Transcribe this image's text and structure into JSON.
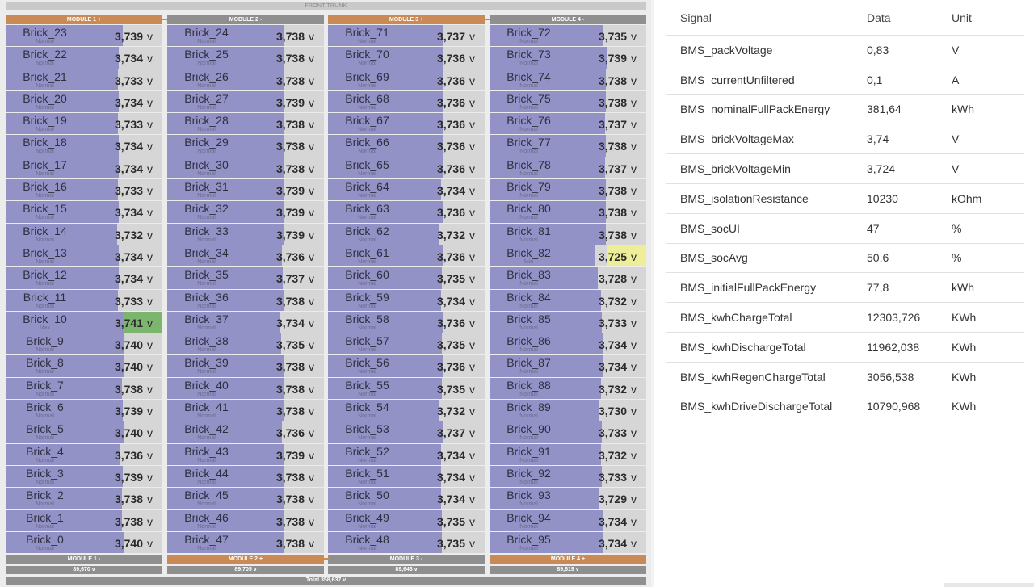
{
  "front_trunk": "FRONT TRUNK",
  "colors": {
    "positive": "#c98a55",
    "negative": "#8f8f8f",
    "bar": "#9392c6",
    "track": "#d6d6d6",
    "max_highlight": "#7cb56e",
    "min_highlight": "#eeee99"
  },
  "fill_scale": {
    "min_voltage": 3.7,
    "max_voltage": 3.745
  },
  "modules": [
    {
      "header": "MODULE 1 +",
      "header_kind": "positive",
      "footer": "MODULE 1 -",
      "footer_kind": "negative",
      "total": "89,670 v",
      "bricks": [
        {
          "name": "Brick_23",
          "status": "Normal",
          "voltage": "3,739"
        },
        {
          "name": "Brick_22",
          "status": "Normal",
          "voltage": "3,734"
        },
        {
          "name": "Brick_21",
          "status": "Normal",
          "voltage": "3,733"
        },
        {
          "name": "Brick_20",
          "status": "Normal",
          "voltage": "3,734"
        },
        {
          "name": "Brick_19",
          "status": "Normal",
          "voltage": "3,733"
        },
        {
          "name": "Brick_18",
          "status": "Normal",
          "voltage": "3,734"
        },
        {
          "name": "Brick_17",
          "status": "Normal",
          "voltage": "3,734"
        },
        {
          "name": "Brick_16",
          "status": "Normal",
          "voltage": "3,733"
        },
        {
          "name": "Brick_15",
          "status": "Normal",
          "voltage": "3,734"
        },
        {
          "name": "Brick_14",
          "status": "Normal",
          "voltage": "3,732"
        },
        {
          "name": "Brick_13",
          "status": "Normal",
          "voltage": "3,734"
        },
        {
          "name": "Brick_12",
          "status": "Normal",
          "voltage": "3,734"
        },
        {
          "name": "Brick_11",
          "status": "Normal",
          "voltage": "3,733"
        },
        {
          "name": "Brick_10",
          "status": "Max",
          "voltage": "3,741"
        },
        {
          "name": "Brick_9",
          "status": "Normal",
          "voltage": "3,740"
        },
        {
          "name": "Brick_8",
          "status": "Normal",
          "voltage": "3,740"
        },
        {
          "name": "Brick_7",
          "status": "Normal",
          "voltage": "3,738"
        },
        {
          "name": "Brick_6",
          "status": "Normal",
          "voltage": "3,739"
        },
        {
          "name": "Brick_5",
          "status": "Normal",
          "voltage": "3,740"
        },
        {
          "name": "Brick_4",
          "status": "Normal",
          "voltage": "3,736"
        },
        {
          "name": "Brick_3",
          "status": "Normal",
          "voltage": "3,739"
        },
        {
          "name": "Brick_2",
          "status": "Normal",
          "voltage": "3,738"
        },
        {
          "name": "Brick_1",
          "status": "Normal",
          "voltage": "3,738"
        },
        {
          "name": "Brick_0",
          "status": "Normal",
          "voltage": "3,740"
        }
      ]
    },
    {
      "header": "MODULE 2 -",
      "header_kind": "negative",
      "footer": "MODULE 2 +",
      "footer_kind": "positive",
      "total": "89,705 v",
      "bricks": [
        {
          "name": "Brick_24",
          "status": "Normal",
          "voltage": "3,738"
        },
        {
          "name": "Brick_25",
          "status": "Normal",
          "voltage": "3,738"
        },
        {
          "name": "Brick_26",
          "status": "Normal",
          "voltage": "3,738"
        },
        {
          "name": "Brick_27",
          "status": "Normal",
          "voltage": "3,739"
        },
        {
          "name": "Brick_28",
          "status": "Normal",
          "voltage": "3,738"
        },
        {
          "name": "Brick_29",
          "status": "Normal",
          "voltage": "3,738"
        },
        {
          "name": "Brick_30",
          "status": "Normal",
          "voltage": "3,738"
        },
        {
          "name": "Brick_31",
          "status": "Normal",
          "voltage": "3,739"
        },
        {
          "name": "Brick_32",
          "status": "Normal",
          "voltage": "3,739"
        },
        {
          "name": "Brick_33",
          "status": "Normal",
          "voltage": "3,739"
        },
        {
          "name": "Brick_34",
          "status": "Normal",
          "voltage": "3,736"
        },
        {
          "name": "Brick_35",
          "status": "Normal",
          "voltage": "3,737"
        },
        {
          "name": "Brick_36",
          "status": "Normal",
          "voltage": "3,738"
        },
        {
          "name": "Brick_37",
          "status": "Normal",
          "voltage": "3,734"
        },
        {
          "name": "Brick_38",
          "status": "Normal",
          "voltage": "3,735"
        },
        {
          "name": "Brick_39",
          "status": "Normal",
          "voltage": "3,738"
        },
        {
          "name": "Brick_40",
          "status": "Normal",
          "voltage": "3,738"
        },
        {
          "name": "Brick_41",
          "status": "Normal",
          "voltage": "3,738"
        },
        {
          "name": "Brick_42",
          "status": "Normal",
          "voltage": "3,736"
        },
        {
          "name": "Brick_43",
          "status": "Normal",
          "voltage": "3,739"
        },
        {
          "name": "Brick_44",
          "status": "Normal",
          "voltage": "3,738"
        },
        {
          "name": "Brick_45",
          "status": "Normal",
          "voltage": "3,738"
        },
        {
          "name": "Brick_46",
          "status": "Normal",
          "voltage": "3,738"
        },
        {
          "name": "Brick_47",
          "status": "Normal",
          "voltage": "3,738"
        }
      ]
    },
    {
      "header": "MODULE 3 +",
      "header_kind": "positive",
      "footer": "MODULE 3 -",
      "footer_kind": "negative",
      "total": "89,643 v",
      "bricks": [
        {
          "name": "Brick_71",
          "status": "Normal",
          "voltage": "3,737"
        },
        {
          "name": "Brick_70",
          "status": "Normal",
          "voltage": "3,736"
        },
        {
          "name": "Brick_69",
          "status": "Normal",
          "voltage": "3,736"
        },
        {
          "name": "Brick_68",
          "status": "Normal",
          "voltage": "3,736"
        },
        {
          "name": "Brick_67",
          "status": "Normal",
          "voltage": "3,736"
        },
        {
          "name": "Brick_66",
          "status": "Normal",
          "voltage": "3,736"
        },
        {
          "name": "Brick_65",
          "status": "Normal",
          "voltage": "3,736"
        },
        {
          "name": "Brick_64",
          "status": "Normal",
          "voltage": "3,734"
        },
        {
          "name": "Brick_63",
          "status": "Normal",
          "voltage": "3,736"
        },
        {
          "name": "Brick_62",
          "status": "Normal",
          "voltage": "3,732"
        },
        {
          "name": "Brick_61",
          "status": "Normal",
          "voltage": "3,736"
        },
        {
          "name": "Brick_60",
          "status": "Normal",
          "voltage": "3,735"
        },
        {
          "name": "Brick_59",
          "status": "Normal",
          "voltage": "3,734"
        },
        {
          "name": "Brick_58",
          "status": "Normal",
          "voltage": "3,736"
        },
        {
          "name": "Brick_57",
          "status": "Normal",
          "voltage": "3,735"
        },
        {
          "name": "Brick_56",
          "status": "Normal",
          "voltage": "3,736"
        },
        {
          "name": "Brick_55",
          "status": "Normal",
          "voltage": "3,735"
        },
        {
          "name": "Brick_54",
          "status": "Normal",
          "voltage": "3,732"
        },
        {
          "name": "Brick_53",
          "status": "Normal",
          "voltage": "3,737"
        },
        {
          "name": "Brick_52",
          "status": "Normal",
          "voltage": "3,734"
        },
        {
          "name": "Brick_51",
          "status": "Normal",
          "voltage": "3,734"
        },
        {
          "name": "Brick_50",
          "status": "Normal",
          "voltage": "3,734"
        },
        {
          "name": "Brick_49",
          "status": "Normal",
          "voltage": "3,735"
        },
        {
          "name": "Brick_48",
          "status": "Normal",
          "voltage": "3,735"
        }
      ]
    },
    {
      "header": "MODULE 4 -",
      "header_kind": "negative",
      "footer": "MODULE 4 +",
      "footer_kind": "positive",
      "total": "89,619 v",
      "bricks": [
        {
          "name": "Brick_72",
          "status": "Normal",
          "voltage": "3,735"
        },
        {
          "name": "Brick_73",
          "status": "Normal",
          "voltage": "3,739"
        },
        {
          "name": "Brick_74",
          "status": "Normal",
          "voltage": "3,738"
        },
        {
          "name": "Brick_75",
          "status": "Normal",
          "voltage": "3,738"
        },
        {
          "name": "Brick_76",
          "status": "Normal",
          "voltage": "3,737"
        },
        {
          "name": "Brick_77",
          "status": "Normal",
          "voltage": "3,738"
        },
        {
          "name": "Brick_78",
          "status": "Normal",
          "voltage": "3,737"
        },
        {
          "name": "Brick_79",
          "status": "Normal",
          "voltage": "3,738"
        },
        {
          "name": "Brick_80",
          "status": "Normal",
          "voltage": "3,738"
        },
        {
          "name": "Brick_81",
          "status": "Normal",
          "voltage": "3,738"
        },
        {
          "name": "Brick_82",
          "status": "Min",
          "voltage": "3,725"
        },
        {
          "name": "Brick_83",
          "status": "Normal",
          "voltage": "3,728"
        },
        {
          "name": "Brick_84",
          "status": "Normal",
          "voltage": "3,732"
        },
        {
          "name": "Brick_85",
          "status": "Normal",
          "voltage": "3,733"
        },
        {
          "name": "Brick_86",
          "status": "Normal",
          "voltage": "3,734"
        },
        {
          "name": "Brick_87",
          "status": "Normal",
          "voltage": "3,734"
        },
        {
          "name": "Brick_88",
          "status": "Normal",
          "voltage": "3,732"
        },
        {
          "name": "Brick_89",
          "status": "Normal",
          "voltage": "3,730"
        },
        {
          "name": "Brick_90",
          "status": "Normal",
          "voltage": "3,733"
        },
        {
          "name": "Brick_91",
          "status": "Normal",
          "voltage": "3,732"
        },
        {
          "name": "Brick_92",
          "status": "Normal",
          "voltage": "3,733"
        },
        {
          "name": "Brick_93",
          "status": "Normal",
          "voltage": "3,729"
        },
        {
          "name": "Brick_94",
          "status": "Normal",
          "voltage": "3,734"
        },
        {
          "name": "Brick_95",
          "status": "Normal",
          "voltage": "3,734"
        }
      ]
    }
  ],
  "unit_label": "v",
  "pack_total": "Total 358,637 v",
  "signals_table": {
    "headers": {
      "signal": "Signal",
      "data": "Data",
      "unit": "Unit"
    },
    "rows": [
      {
        "signal": "BMS_packVoltage",
        "data": "0,83",
        "unit": "V"
      },
      {
        "signal": "BMS_currentUnfiltered",
        "data": "0,1",
        "unit": "A"
      },
      {
        "signal": "BMS_nominalFullPackEnergy",
        "data": "381,64",
        "unit": "kWh"
      },
      {
        "signal": "BMS_brickVoltageMax",
        "data": "3,74",
        "unit": "V"
      },
      {
        "signal": "BMS_brickVoltageMin",
        "data": "3,724",
        "unit": "V"
      },
      {
        "signal": "BMS_isolationResistance",
        "data": "10230",
        "unit": "kOhm"
      },
      {
        "signal": "BMS_socUI",
        "data": "47",
        "unit": "%"
      },
      {
        "signal": "BMS_socAvg",
        "data": "50,6",
        "unit": "%"
      },
      {
        "signal": "BMS_initialFullPackEnergy",
        "data": "77,8",
        "unit": "kWh"
      },
      {
        "signal": "BMS_kwhChargeTotal",
        "data": "12303,726",
        "unit": "KWh"
      },
      {
        "signal": "BMS_kwhDischargeTotal",
        "data": "11962,038",
        "unit": "KWh"
      },
      {
        "signal": "BMS_kwhRegenChargeTotal",
        "data": "3056,538",
        "unit": "KWh"
      },
      {
        "signal": "BMS_kwhDriveDischargeTotal",
        "data": "10790,968",
        "unit": "KWh"
      }
    ]
  }
}
